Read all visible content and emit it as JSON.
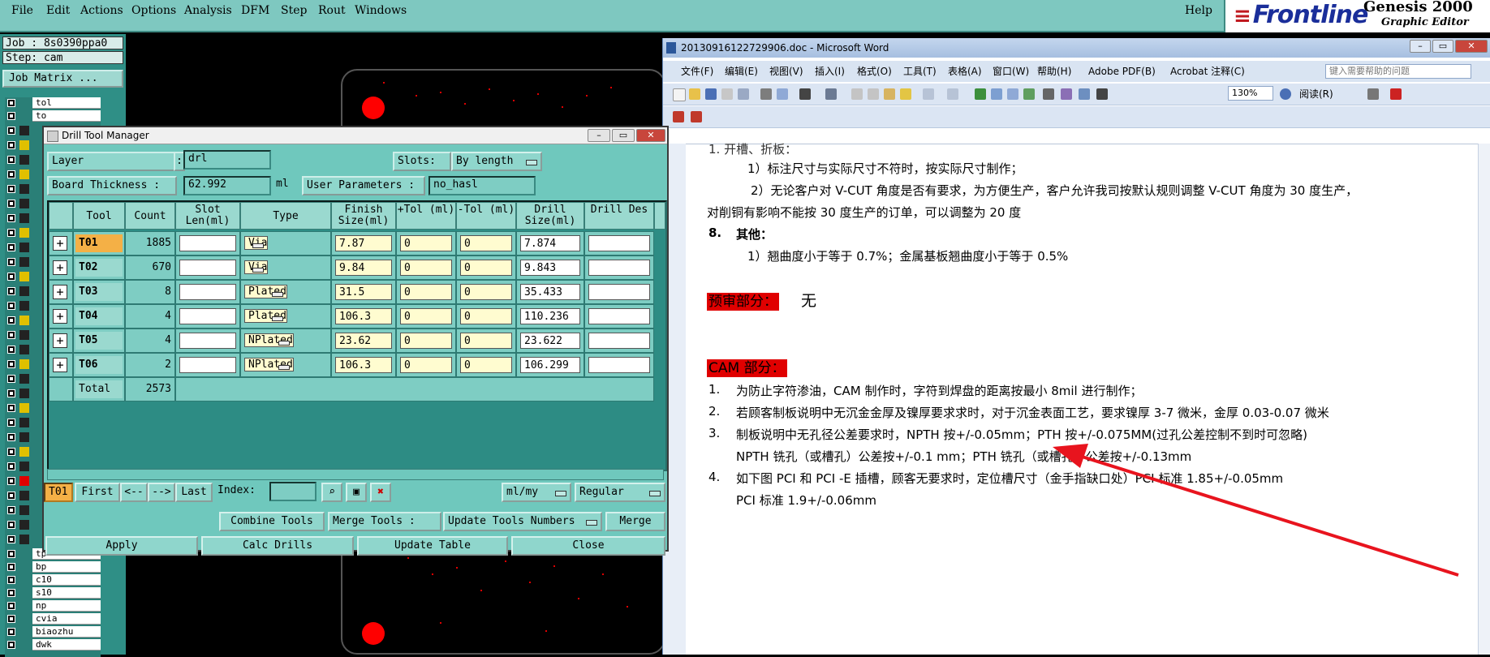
{
  "genesis": {
    "menu": [
      "File",
      "Edit",
      "Actions",
      "Options",
      "Analysis",
      "DFM",
      "Step",
      "Rout",
      "Windows"
    ],
    "help": "Help",
    "brand": "Frontline",
    "product": "Genesis 2000",
    "product_sub": "Graphic Editor",
    "job": "Job : 8s0390ppa0",
    "step": "Step: cam",
    "job_matrix": "Job Matrix ...",
    "layers": [
      "tol",
      "to",
      "tp",
      "bp",
      "c10",
      "s10",
      "np",
      "cvia",
      "biaozhu",
      "dwk"
    ]
  },
  "dtm": {
    "title": "Drill Tool Manager",
    "layer_label": "Layer",
    "layer_value": "drl",
    "slots_label": "Slots:",
    "slots_value": "By length",
    "thickness_label": "Board Thickness :",
    "thickness_value": "62.992",
    "thickness_unit": "ml",
    "user_params_label": "User Parameters :",
    "user_params_value": "no_hasl",
    "columns": [
      "Tool",
      "Count",
      "Slot Len(ml)",
      "Type",
      "Finish Size(ml)",
      "+Tol (ml)",
      "-Tol (ml)",
      "Drill Size(ml)",
      "Drill Des"
    ],
    "rows": [
      {
        "tool": "T01",
        "count": "1885",
        "type": "Via",
        "finish": "7.87",
        "ptol": "0",
        "ntol": "0",
        "drill": "7.874"
      },
      {
        "tool": "T02",
        "count": "670",
        "type": "Via",
        "finish": "9.84",
        "ptol": "0",
        "ntol": "0",
        "drill": "9.843"
      },
      {
        "tool": "T03",
        "count": "8",
        "type": "Plated",
        "finish": "31.5",
        "ptol": "0",
        "ntol": "0",
        "drill": "35.433"
      },
      {
        "tool": "T04",
        "count": "4",
        "type": "Plated",
        "finish": "106.3",
        "ptol": "0",
        "ntol": "0",
        "drill": "110.236"
      },
      {
        "tool": "T05",
        "count": "4",
        "type": "NPlated",
        "finish": "23.62",
        "ptol": "0",
        "ntol": "0",
        "drill": "23.622"
      },
      {
        "tool": "T06",
        "count": "2",
        "type": "NPlated",
        "finish": "106.3",
        "ptol": "0",
        "ntol": "0",
        "drill": "106.299"
      }
    ],
    "total_label": "Total",
    "total_value": "2573",
    "current_tool": "T01",
    "nav": {
      "first": "First",
      "prev": "<--",
      "next": "-->",
      "last": "Last",
      "index": "Index:"
    },
    "unit_option": "ml/my",
    "mode_option": "Regular",
    "combine": "Combine Tools",
    "merge_label": "Merge Tools :",
    "merge_option": "Update Tools Numbers",
    "merge": "Merge",
    "apply": "Apply",
    "calc": "Calc Drills",
    "update": "Update Table",
    "close": "Close"
  },
  "word": {
    "title": "20130916122729906.doc - Microsoft Word",
    "menu": [
      "文件(F)",
      "编辑(E)",
      "视图(V)",
      "插入(I)",
      "格式(O)",
      "工具(T)",
      "表格(A)",
      "窗口(W)",
      "帮助(H)",
      "Adobe PDF(B)",
      "Acrobat 注释(C)"
    ],
    "search_placeholder": "键入需要帮助的问题",
    "zoom": "130%",
    "read_mode": "阅读(R)",
    "lines": {
      "l0": "1.   开槽、折板：",
      "l1": "1）标注尺寸与实际尺寸不符时，按实际尺寸制作；",
      "l2": "2）无论客户对 V-CUT 角度是否有要求，为方便生产，客户允许我司按默认规则调整 V-CUT 角度为 30 度生产，",
      "l3": "对削铜有影响不能按 30 度生产的订单，可以调整为 20 度",
      "l4num": "8.",
      "l4": "其他：",
      "l5": "1）翘曲度小于等于 0.7%；金属基板翘曲度小于等于 0.5%",
      "pre_heading": "预审部分：",
      "pre_value": "无",
      "cam_heading": "CAM 部分：",
      "i1": "为防止字符渗油，CAM 制作时，字符到焊盘的距离按最小 8mil 进行制作；",
      "i2": "若顾客制板说明中无沉金金厚及镍厚要求求时，对于沉金表面工艺，要求镍厚 3-7 微米，金厚 0.03-0.07 微米",
      "i3": "制板说明中无孔径公差要求时，NPTH 按+/-0.05mm；PTH 按+/-0.075MM(过孔公差控制不到时可忽略)",
      "i3b": "NPTH 铣孔（或槽孔）公差按+/-0.1 mm；PTH 铣孔（或槽孔）公差按+/-0.13mm",
      "i4": "如下图 PCI 和 PCI -E 插槽，顾客无要求时，定位槽尺寸（金手指缺口处）PCI 标准 1.85+/-0.05mm",
      "i4b": "PCI 标准 1.9+/-0.06mm"
    },
    "nums": [
      "1.",
      "2.",
      "3.",
      "4."
    ]
  },
  "colors": {
    "genesis_teal": "#6fc8bd",
    "active_tool": "#f4b046",
    "highlight_red": "#e00000",
    "annotation_arrow": "#e8141e"
  }
}
